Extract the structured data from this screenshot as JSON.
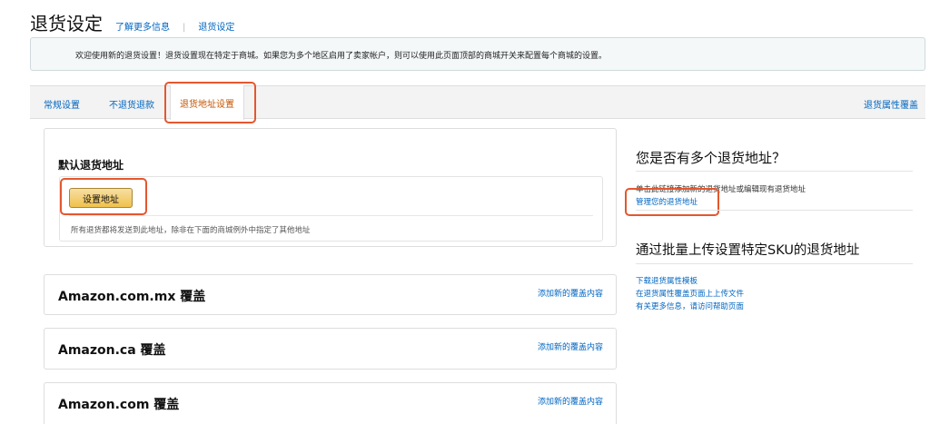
{
  "header": {
    "title": "退货设定",
    "learn_more": "了解更多信息",
    "separator": "|",
    "settings_link": "退货设定"
  },
  "banner": {
    "text": "欢迎使用新的退货设置！退货设置现在特定于商城。如果您为多个地区启用了卖家帐户，则可以使用此页面顶部的商城开关来配置每个商城的设置。"
  },
  "tabs": [
    {
      "label": "常规设置",
      "active": false
    },
    {
      "label": "不退货退款",
      "active": false
    },
    {
      "label": "退货地址设置",
      "active": true
    }
  ],
  "tabs_right_link": "退货属性覆盖",
  "default_address": {
    "heading": "默认退货地址",
    "button": "设置地址",
    "note": "所有退货都将发送到此地址，除非在下面的商城例外中指定了其他地址"
  },
  "overrides": [
    {
      "title": "Amazon.com.mx 覆盖",
      "link": "添加新的覆盖内容"
    },
    {
      "title": "Amazon.ca 覆盖",
      "link": "添加新的覆盖内容"
    },
    {
      "title": "Amazon.com 覆盖",
      "link": "添加新的覆盖内容"
    }
  ],
  "right_panel": {
    "multi_heading": "您是否有多个退货地址？",
    "multi_text": "单击此链接添加新的退货地址或编辑现有退货地址",
    "manage_link": "管理您的退货地址",
    "bulk_heading": "通过批量上传设置特定SKU的退货地址",
    "bulk_links": [
      "下载退货属性模板",
      "在退货属性覆盖页面上上传文件",
      "有关更多信息，请访问帮助页面"
    ]
  },
  "colors": {
    "link": "#0066c0",
    "active_tab": "#c45500",
    "highlight": "#e4572e",
    "button": "#f0c14b"
  }
}
